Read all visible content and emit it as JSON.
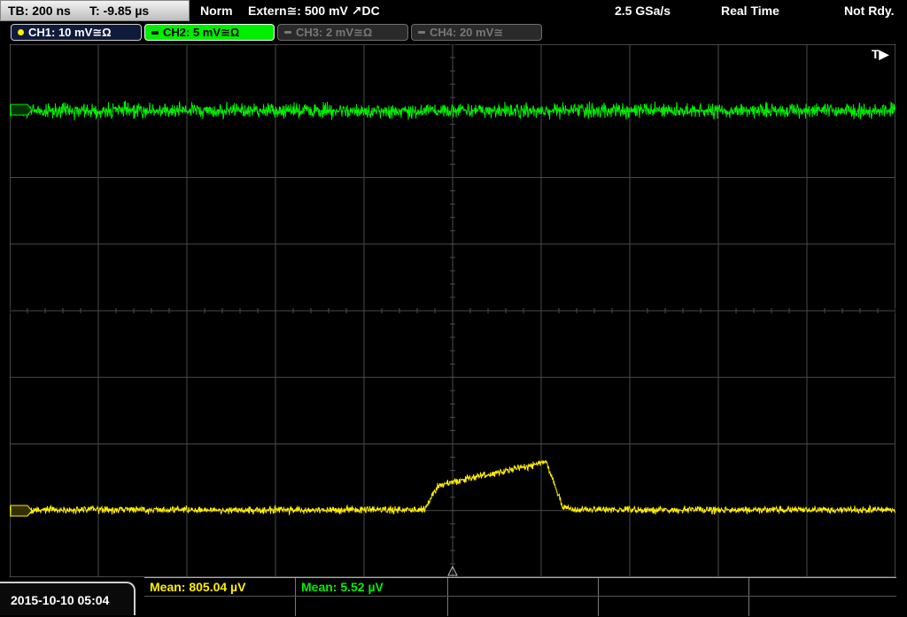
{
  "topbar": {
    "timebase": "TB: 200 ns",
    "trigger_time": "T: -9.85 µs",
    "mode": "Norm",
    "trigger_source": "Extern≅: 500 mV ↗DC",
    "sample_rate": "2.5 GSa/s",
    "acquisition": "Real Time",
    "status": "Not Rdy."
  },
  "channels": [
    {
      "label": "CH1: 10 mV≅Ω",
      "color": "#ffee00",
      "active": true
    },
    {
      "label": "CH2: 5 mV≅Ω",
      "color": "#00ee00",
      "active": true
    },
    {
      "label": "CH3: 2 mV≅Ω",
      "color": "#777777",
      "active": false
    },
    {
      "label": "CH4: 20 mV≅",
      "color": "#777777",
      "active": false
    }
  ],
  "trigger_marker": "T▶",
  "measurements": {
    "ch1_mean": "Mean: 805.04 µV",
    "ch2_mean": "Mean: 5.52 µV"
  },
  "datetime": "2015-10-10 05:04",
  "colors": {
    "ch1": "#ffee00",
    "ch2": "#00ee00",
    "grid": "#4a4a4a"
  }
}
